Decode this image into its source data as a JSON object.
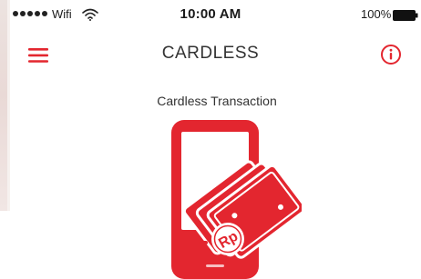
{
  "status_bar": {
    "carrier": "Wifi",
    "time": "10:00 AM",
    "battery": "100%"
  },
  "nav": {
    "title": "CARDLESS",
    "menu_icon": "hamburger-menu-icon",
    "info_icon": "info-circle-icon"
  },
  "content": {
    "subtitle": "Cardless Transaction",
    "illustration_icon": "phone-with-money-icon",
    "currency_mark": "Rp"
  },
  "colors": {
    "accent": "#e3262f",
    "text": "#333333"
  }
}
